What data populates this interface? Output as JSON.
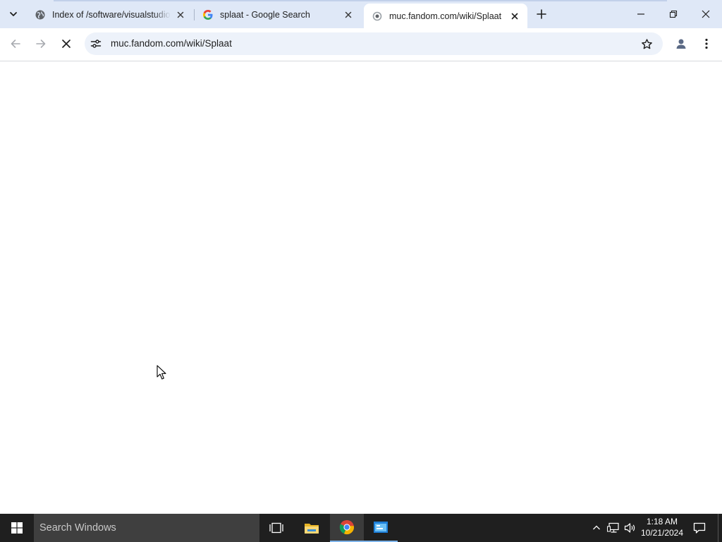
{
  "browser": {
    "tabs": [
      {
        "title": "Index of /software/visualstudio",
        "favicon": "globe-icon",
        "active": false
      },
      {
        "title": "splaat - Google Search",
        "favicon": "google-g-icon",
        "active": false
      },
      {
        "title": "muc.fandom.com/wiki/Splaat",
        "favicon": "loading-globe-icon",
        "active": true
      }
    ],
    "new_tab_icon": "plus-icon",
    "tab_search_icon": "chevron-down-icon",
    "window_controls": [
      "minimize-icon",
      "restore-icon",
      "close-icon"
    ]
  },
  "toolbar": {
    "back_icon": "arrow-left-icon",
    "forward_icon": "arrow-right-icon",
    "stop_icon": "stop-loading-icon",
    "site_info_icon": "tune-icon",
    "url": "muc.fandom.com/wiki/Splaat",
    "bookmark_icon": "star-outline-icon",
    "profile_icon": "profile-icon",
    "menu_icon": "kebab-menu-icon"
  },
  "page": {
    "state": "loading (blank)"
  },
  "taskbar": {
    "search_placeholder": "Search Windows",
    "apps": [
      "task-view-icon",
      "file-explorer-icon",
      "chrome-icon",
      "control-panel-icon"
    ],
    "tray_icons": [
      "chevron-up-icon",
      "network-icon",
      "volume-icon"
    ],
    "time": "1:18 AM",
    "date": "10/21/2024"
  },
  "colors": {
    "tabstrip_bg": "#dfe8f7",
    "omnibox_bg": "#edf2fa",
    "taskbar_bg": "#1f1f1f",
    "taskbar_search_bg": "#3f3f3f",
    "accent": "#1a73e8"
  }
}
